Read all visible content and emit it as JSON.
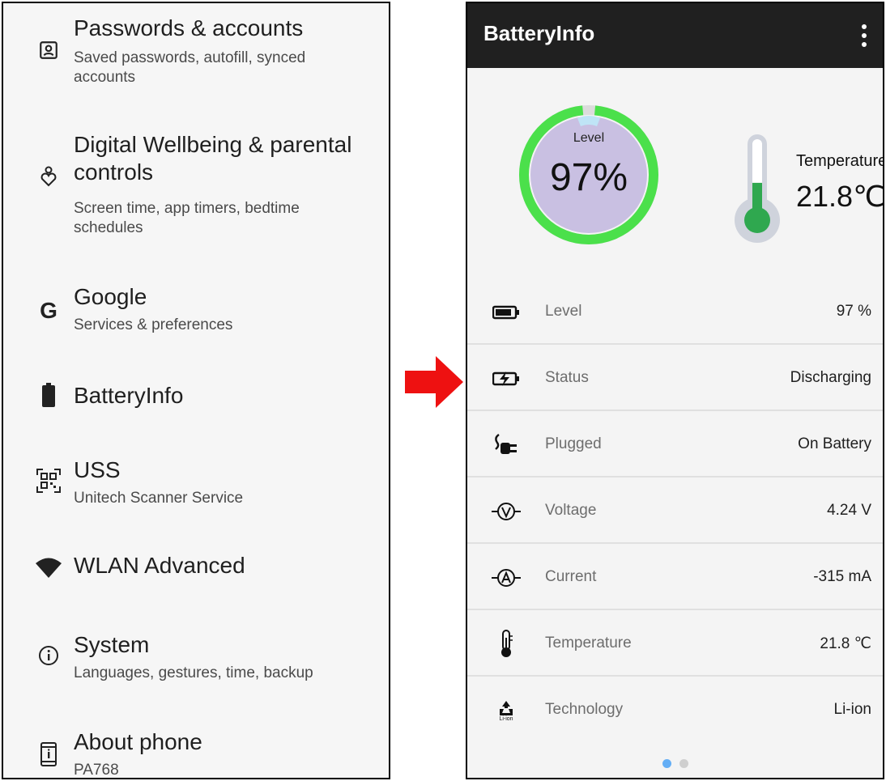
{
  "settings": {
    "items": [
      {
        "title": "Passwords & accounts",
        "subtitle": "Saved passwords, autofill, synced accounts",
        "icon": "account-box-icon"
      },
      {
        "title": "Digital Wellbeing & parental controls",
        "subtitle": "Screen time, app timers, bedtime schedules",
        "icon": "wellbeing-icon"
      },
      {
        "title": "Google",
        "subtitle": "Services & preferences",
        "icon": "google-icon"
      },
      {
        "title": "BatteryInfo",
        "subtitle": "",
        "icon": "battery-icon"
      },
      {
        "title": "USS",
        "subtitle": "Unitech Scanner Service",
        "icon": "qr-code-icon"
      },
      {
        "title": "WLAN Advanced",
        "subtitle": "",
        "icon": "wifi-icon"
      },
      {
        "title": "System",
        "subtitle": "Languages, gestures, time, backup",
        "icon": "info-icon"
      },
      {
        "title": "About phone",
        "subtitle": "PA768",
        "icon": "phone-info-icon"
      }
    ]
  },
  "app": {
    "title": "BatteryInfo",
    "gauge": {
      "label": "Level",
      "value": "97%",
      "level": 0.97,
      "color": "#4be04b",
      "fill": "#c9c0e2"
    },
    "thermometer": {
      "label": "Temperature",
      "value": "21.8℃",
      "fill_fraction": 0.45,
      "color": "#2fa84f"
    },
    "rows": [
      {
        "label": "Level",
        "value": "97 %",
        "icon": "battery-level-icon"
      },
      {
        "label": "Status",
        "value": "Discharging",
        "icon": "battery-charging-icon"
      },
      {
        "label": "Plugged",
        "value": "On Battery",
        "icon": "plug-icon"
      },
      {
        "label": "Voltage",
        "value": "4.24 V",
        "icon": "voltmeter-icon"
      },
      {
        "label": "Current",
        "value": "-315 mA",
        "icon": "ammeter-icon"
      },
      {
        "label": "Temperature",
        "value": "21.8 ℃",
        "icon": "thermometer-icon"
      },
      {
        "label": "Technology",
        "value": "Li-ion",
        "icon": "recycle-li-ion-icon",
        "icon_caption": "Li-ion"
      }
    ],
    "page_dots": {
      "count": 2,
      "active": 0,
      "active_color": "#64aef5",
      "inactive_color": "#cfcfcf"
    }
  },
  "colors": {
    "arrow": "#ee1111",
    "appbar": "#202020"
  }
}
